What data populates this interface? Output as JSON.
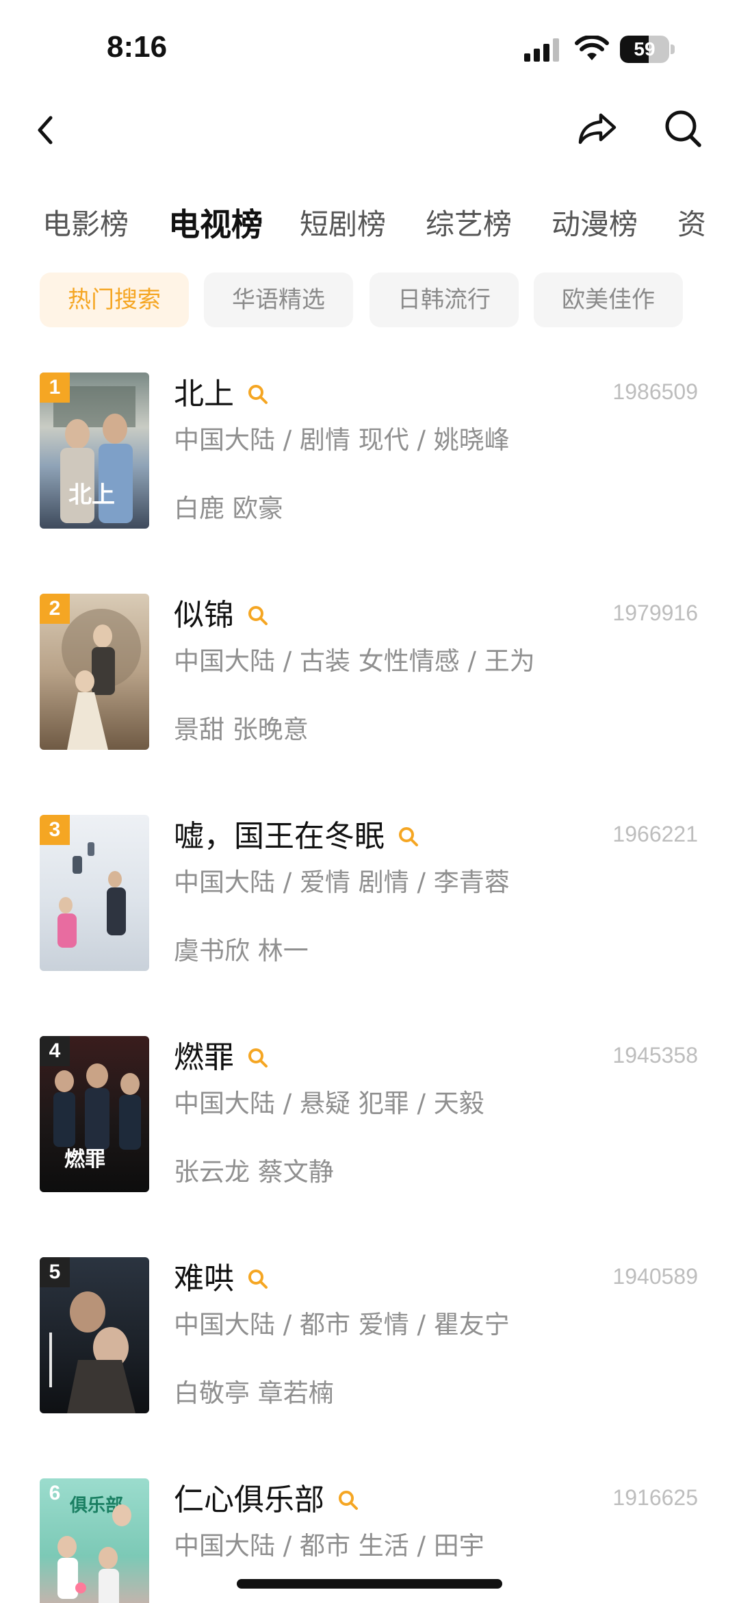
{
  "status_bar": {
    "time": "8:16",
    "battery": "59",
    "battery_level": 0.59
  },
  "category_tabs": [
    {
      "label": "电影榜",
      "active": false
    },
    {
      "label": "电视榜",
      "active": true
    },
    {
      "label": "短剧榜",
      "active": false
    },
    {
      "label": "综艺榜",
      "active": false
    },
    {
      "label": "动漫榜",
      "active": false
    },
    {
      "label": "资",
      "active": false
    }
  ],
  "filter_chips": [
    {
      "label": "热门搜索",
      "active": true
    },
    {
      "label": "华语精选",
      "active": false
    },
    {
      "label": "日韩流行",
      "active": false
    },
    {
      "label": "欧美佳作",
      "active": false
    }
  ],
  "colors": {
    "accent": "#f5a623",
    "rank_top": "#f5a623",
    "rank_other": "#222222"
  },
  "items": [
    {
      "rank": "1",
      "title": "北上",
      "score": "1986509",
      "meta": "中国大陆 / 剧情 现代 / 姚晓峰",
      "cast": "白鹿 欧豪"
    },
    {
      "rank": "2",
      "title": "似锦",
      "score": "1979916",
      "meta": "中国大陆 / 古装 女性情感 / 王为",
      "cast": "景甜 张晚意"
    },
    {
      "rank": "3",
      "title": "嘘，国王在冬眠",
      "score": "1966221",
      "meta": "中国大陆 / 爱情 剧情 / 李青蓉",
      "cast": "虞书欣 林一"
    },
    {
      "rank": "4",
      "title": "燃罪",
      "score": "1945358",
      "meta": "中国大陆 / 悬疑 犯罪 / 天毅",
      "cast": "张云龙 蔡文静"
    },
    {
      "rank": "5",
      "title": "难哄",
      "score": "1940589",
      "meta": "中国大陆 / 都市 爱情 / 瞿友宁",
      "cast": "白敬亭 章若楠"
    },
    {
      "rank": "6",
      "title": "仁心俱乐部",
      "score": "1916625",
      "meta": "中国大陆 / 都市 生活 / 田宇",
      "cast": ""
    }
  ]
}
